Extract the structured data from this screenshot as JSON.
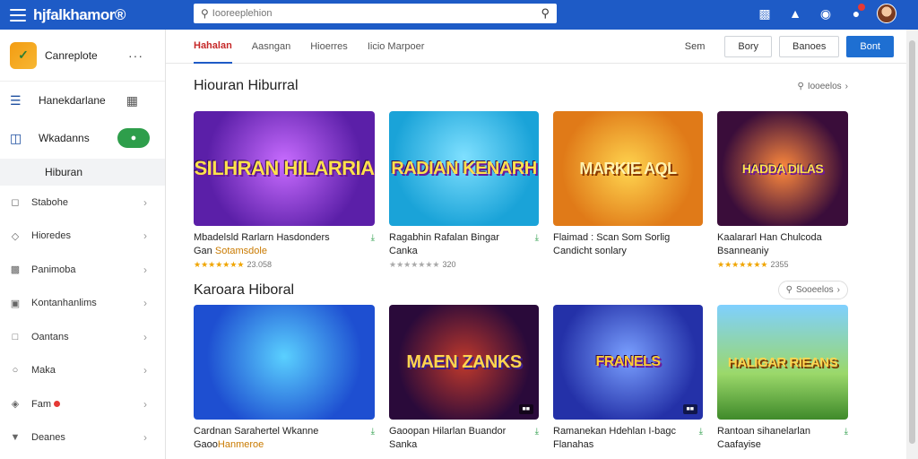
{
  "topbar": {
    "brand": "hjfalkhamor®",
    "search_placeholder": "Iooreeplehion"
  },
  "sidebar": {
    "app_name": "Canreplote",
    "library_label": "Hanekdarlane",
    "downloads_label": "Wkadanns",
    "section_label": "Hiburan",
    "items": [
      {
        "label": "Stabohe",
        "icon": "shield-icon"
      },
      {
        "label": "Hioredes",
        "icon": "tag-icon"
      },
      {
        "label": "Panimoba",
        "icon": "controller-icon"
      },
      {
        "label": "Kontanhanlims",
        "icon": "window-icon"
      },
      {
        "label": "Oantans",
        "icon": "calendar-icon"
      },
      {
        "label": "Maka",
        "icon": "gift-icon"
      },
      {
        "label": "Fam",
        "icon": "pin-icon",
        "dot": true
      },
      {
        "label": "Deanes",
        "icon": "download-icon"
      }
    ]
  },
  "tabs": [
    {
      "label": "Hahalan",
      "active": true
    },
    {
      "label": "Aasngan"
    },
    {
      "label": "Hioerres"
    },
    {
      "label": "Iicio Marpoer"
    }
  ],
  "actions": {
    "link": "Sem",
    "btn1": "Bory",
    "btn2": "Banoes",
    "btn3": "Bont"
  },
  "section1": {
    "title": "Hiouran Hiburral",
    "link": "Iooeelos"
  },
  "section2": {
    "title": "Karoara Hiboral",
    "link": "Sooeelos"
  },
  "cards1": [
    {
      "thumb": "SILHRAN HILARRIA",
      "line1": "Mbadelsld Rarlarn Hasdonders",
      "line2": "Gan",
      "sub": "Sotamsdole",
      "rating": "★★★★★★★",
      "count": "23.058"
    },
    {
      "thumb": "RADIAN KENARH",
      "line1": "Ragabhin Rafalan Bingar",
      "line2": "Canka",
      "sub": "",
      "rating": "★★★★★★★",
      "count": "320"
    },
    {
      "thumb": "MARKIE AQL",
      "line1": "Flaimad : Scan Som Sorlig",
      "line2": "Candicht sonlary",
      "sub": "",
      "rating": "",
      "count": ""
    },
    {
      "thumb": "HADDA DILAS",
      "line1": "Kaalararl Han Chulcoda",
      "line2": "Bsanneaniy",
      "sub": "",
      "rating": "★★★★★★★",
      "count": "2355"
    }
  ],
  "cards2": [
    {
      "thumb": "",
      "line1": "Cardnan Sarahertel Wkanne",
      "line2": "Gaoo",
      "sub": "Hanmeroe",
      "rating": "",
      "count": ""
    },
    {
      "thumb": "MAEN ZANKS",
      "line1": "Gaoopan Hilarlan Buandor",
      "line2": "Sanka",
      "sub": "",
      "rating": "",
      "count": ""
    },
    {
      "thumb": "FRANELS",
      "line1": "Ramanekan Hdehlan I-bagc",
      "line2": "Flanahas",
      "sub": "",
      "rating": "",
      "count": ""
    },
    {
      "thumb": "HALIGAR RIEANS",
      "line1": "Rantoan sihanelarlan",
      "line2": "Caafayise",
      "sub": "",
      "rating": "",
      "count": ""
    }
  ],
  "colors": {
    "topbar": "#1e5bc6",
    "primary_button": "#1e6fd2",
    "toggle": "#2e9e4b"
  }
}
